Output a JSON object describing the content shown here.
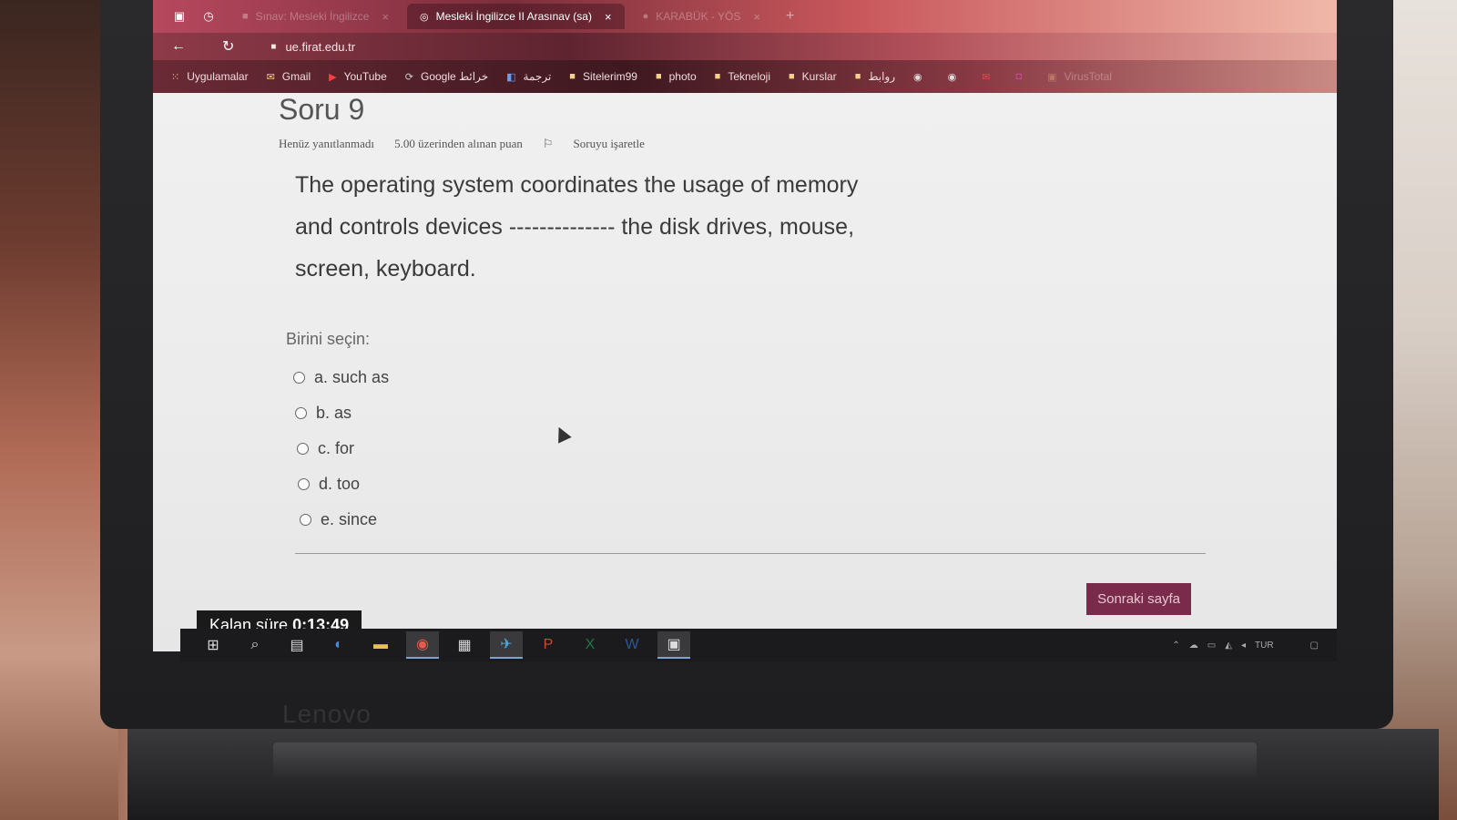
{
  "browser": {
    "tabs": [
      {
        "label": "Sınav: Mesleki İngilizce",
        "state": "faded"
      },
      {
        "label": "Mesleki İngilizce II Arasınav (sa)",
        "state": "active"
      },
      {
        "label": "KARABÜK - YÖS",
        "state": "faded"
      }
    ],
    "url": "ue.firat.edu.tr",
    "bookmarks": [
      {
        "label": "Uygulamalar"
      },
      {
        "label": "Gmail"
      },
      {
        "label": "YouTube"
      },
      {
        "label": "Google خرائط"
      },
      {
        "label": "ترجمة"
      },
      {
        "label": "Sitelerim99"
      },
      {
        "label": "photo"
      },
      {
        "label": "Tekneloji"
      },
      {
        "label": "Kurslar"
      },
      {
        "label": "روابط"
      },
      {
        "label": "VirusTotal"
      }
    ]
  },
  "question": {
    "title": "Soru 9",
    "status": "Henüz yanıtlanmadı",
    "points": "5.00 üzerinden alınan puan",
    "flag_label": "Soruyu işaretle",
    "text_line1": "The operating system coordinates the usage of memory",
    "text_line2": "and controls devices -------------- the disk drives, mouse,",
    "text_line3": "screen, keyboard.",
    "prompt": "Birini seçin:",
    "options": [
      {
        "letter": "a.",
        "text": "such as"
      },
      {
        "letter": "b.",
        "text": "as"
      },
      {
        "letter": "c.",
        "text": "for"
      },
      {
        "letter": "d.",
        "text": "too"
      },
      {
        "letter": "e.",
        "text": "since"
      }
    ],
    "next_button": "Sonraki sayfa"
  },
  "timer": {
    "label": "Kalan süre",
    "value": "0:13:49"
  },
  "taskbar": {
    "tray_lang": "TUR",
    "device_brand": "Lenovo"
  }
}
